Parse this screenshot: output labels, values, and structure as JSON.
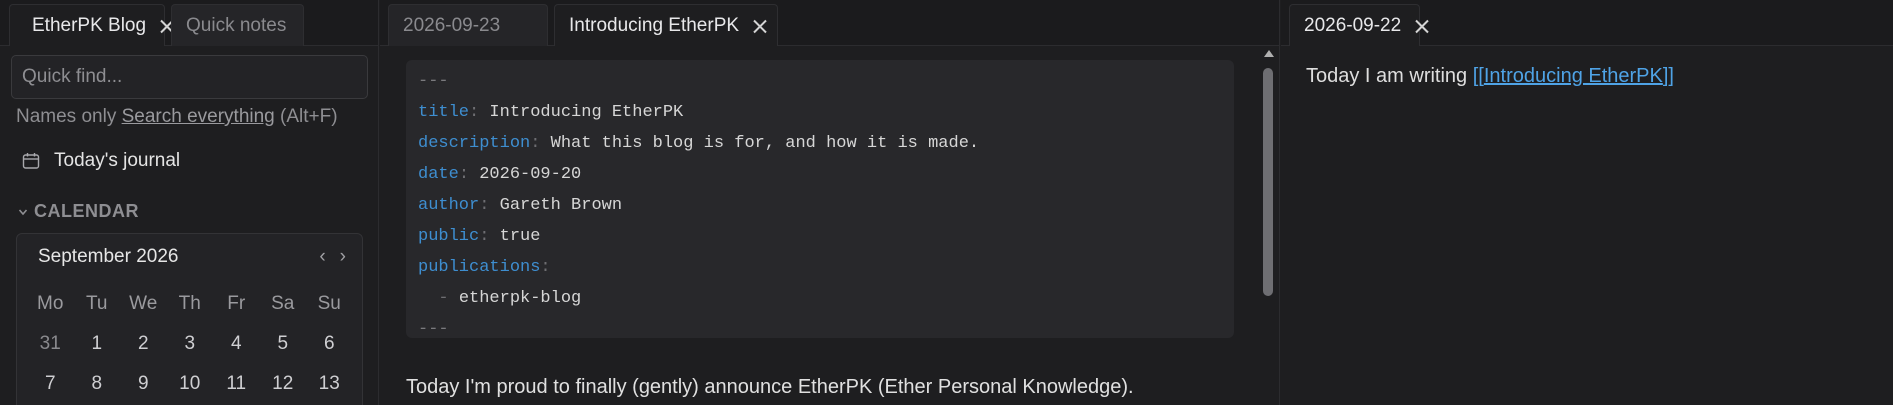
{
  "left_pane": {
    "tabs": [
      {
        "label": "EtherPK Blog",
        "active": true,
        "icon": "graph-icon",
        "closable": true
      },
      {
        "label": "Quick notes",
        "active": false,
        "closable": false
      }
    ],
    "search": {
      "placeholder": "Quick find...",
      "option_names_only": "Names only",
      "option_search_everything": "Search everything",
      "shortcut": "(Alt+F)"
    },
    "journal": {
      "label": "Today's journal",
      "icon": "calendar-icon"
    },
    "calendar_section": {
      "header": "CALENDAR",
      "month": "September 2026",
      "prev": "‹",
      "next": "›",
      "weekdays": [
        "Mo",
        "Tu",
        "We",
        "Th",
        "Fr",
        "Sa",
        "Su"
      ],
      "weeks": [
        [
          "31",
          "1",
          "2",
          "3",
          "4",
          "5",
          "6"
        ],
        [
          "7",
          "8",
          "9",
          "10",
          "11",
          "12",
          "13"
        ]
      ]
    }
  },
  "middle_pane": {
    "tabs": [
      {
        "label": "2026-09-23",
        "active": false,
        "closable": false
      },
      {
        "label": "Introducing EtherPK",
        "active": true,
        "closable": true
      }
    ],
    "frontmatter": {
      "open": "---",
      "fields": [
        {
          "key": "title",
          "value": "Introducing EtherPK"
        },
        {
          "key": "description",
          "value": "What this blog is for, and how it is made."
        },
        {
          "key": "date",
          "value": "2026-09-20"
        },
        {
          "key": "author",
          "value": "Gareth Brown"
        },
        {
          "key": "public",
          "value": "true"
        },
        {
          "key": "publications",
          "value": ""
        }
      ],
      "list_item": "etherpk-blog",
      "close": "---"
    },
    "paragraph": "Today I'm proud to finally (gently) announce EtherPK (Ether Personal Knowledge)."
  },
  "right_pane": {
    "tabs": [
      {
        "label": "2026-09-22",
        "active": true,
        "closable": true
      }
    ],
    "text_prefix": "Today I am writing ",
    "link_open": "[[",
    "link_text": "Introducing EtherPK",
    "link_close": "]]"
  },
  "colors": {
    "background": "#1e1e20",
    "accent_link": "#4fa3e6",
    "frontmatter_key": "#3e8ed0"
  }
}
